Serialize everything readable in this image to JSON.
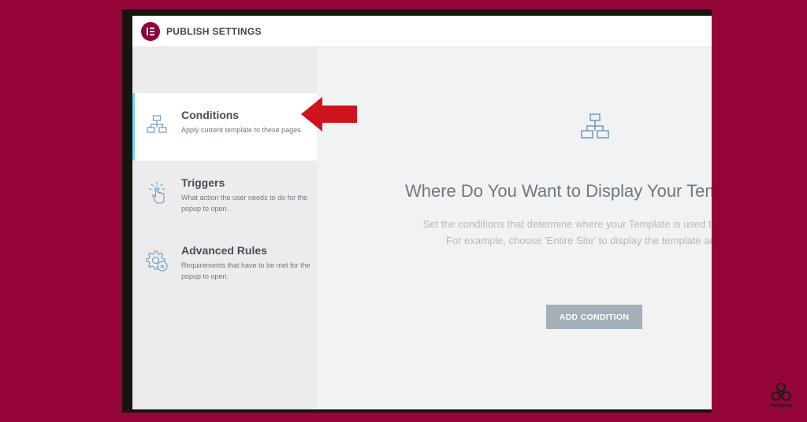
{
  "header": {
    "title": "PUBLISH SETTINGS",
    "logo_icon": "elementor-logo-icon"
  },
  "sidebar": {
    "items": [
      {
        "title": "Conditions",
        "description": "Apply current template to these pages.",
        "icon": "sitemap-icon",
        "active": true
      },
      {
        "title": "Triggers",
        "description": "What action the user needs to do for the popup to open.",
        "icon": "hand-tap-icon",
        "active": false
      },
      {
        "title": "Advanced Rules",
        "description": "Requirements that have to be met for the popup to open.",
        "icon": "gear-star-icon",
        "active": false
      }
    ]
  },
  "main": {
    "icon": "sitemap-icon",
    "title": "Where Do You Want to Display Your Template?",
    "description_line1": "Set the conditions that determine where your Template is used throughout your site.",
    "description_line2": "For example, choose 'Entire Site' to display the template across your site.",
    "add_button_label": "ADD CONDITION"
  },
  "annotation": {
    "icon": "red-arrow-left-icon"
  },
  "brand": {
    "name": "FenixWeb",
    "icon": "triskele-logo-icon"
  },
  "colors": {
    "background": "#940539",
    "logo": "#92003b",
    "active_indicator": "#71d7f7",
    "arrow": "#d0141b",
    "button": "#a4afb7"
  }
}
